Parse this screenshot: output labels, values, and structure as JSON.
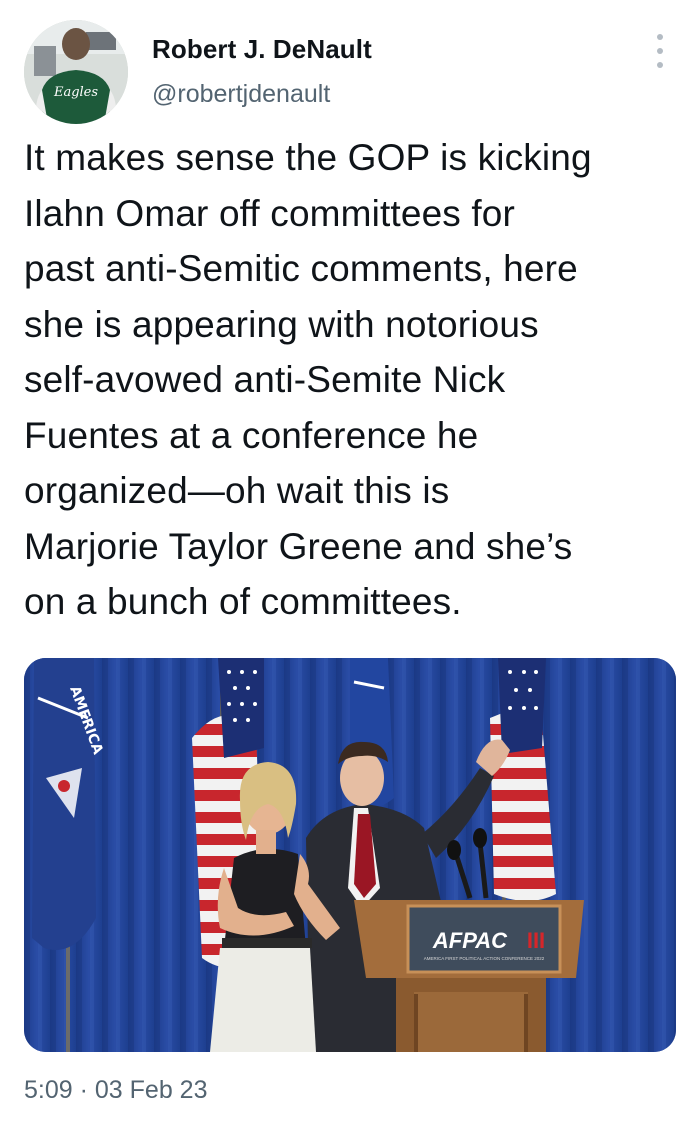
{
  "author": {
    "name": "Robert J. DeNault",
    "handle": "@robertjdenault",
    "avatar_jacket_text": "Eagles"
  },
  "menu": {
    "icon": "more-vertical-icon"
  },
  "tweet": {
    "lines": [
      "It makes sense the GOP is kicking",
      "Ilahn Omar off committees for",
      "past anti-Semitic comments, here",
      "she is appearing with notorious",
      "self-avowed anti-Semite Nick",
      "Fuentes at a conference he",
      "organized—oh wait this is",
      "Marjorie Taylor Greene and she’s",
      "on a bunch of committees."
    ]
  },
  "media": {
    "flag_banner_text": "AMERICA",
    "podium_logo": "AFPAC",
    "podium_logo_mark": "III",
    "podium_subtitle": "AMERICA FIRST POLITICAL ACTION CONFERENCE 2022"
  },
  "meta": {
    "time": "5:09",
    "separator": "·",
    "date": "03 Feb 23"
  },
  "colors": {
    "text_primary": "#0f1419",
    "text_secondary": "#536471",
    "curtain_blue": "#23459a",
    "podium_wood": "#9c6a3a",
    "logo_red": "#d6262a"
  }
}
